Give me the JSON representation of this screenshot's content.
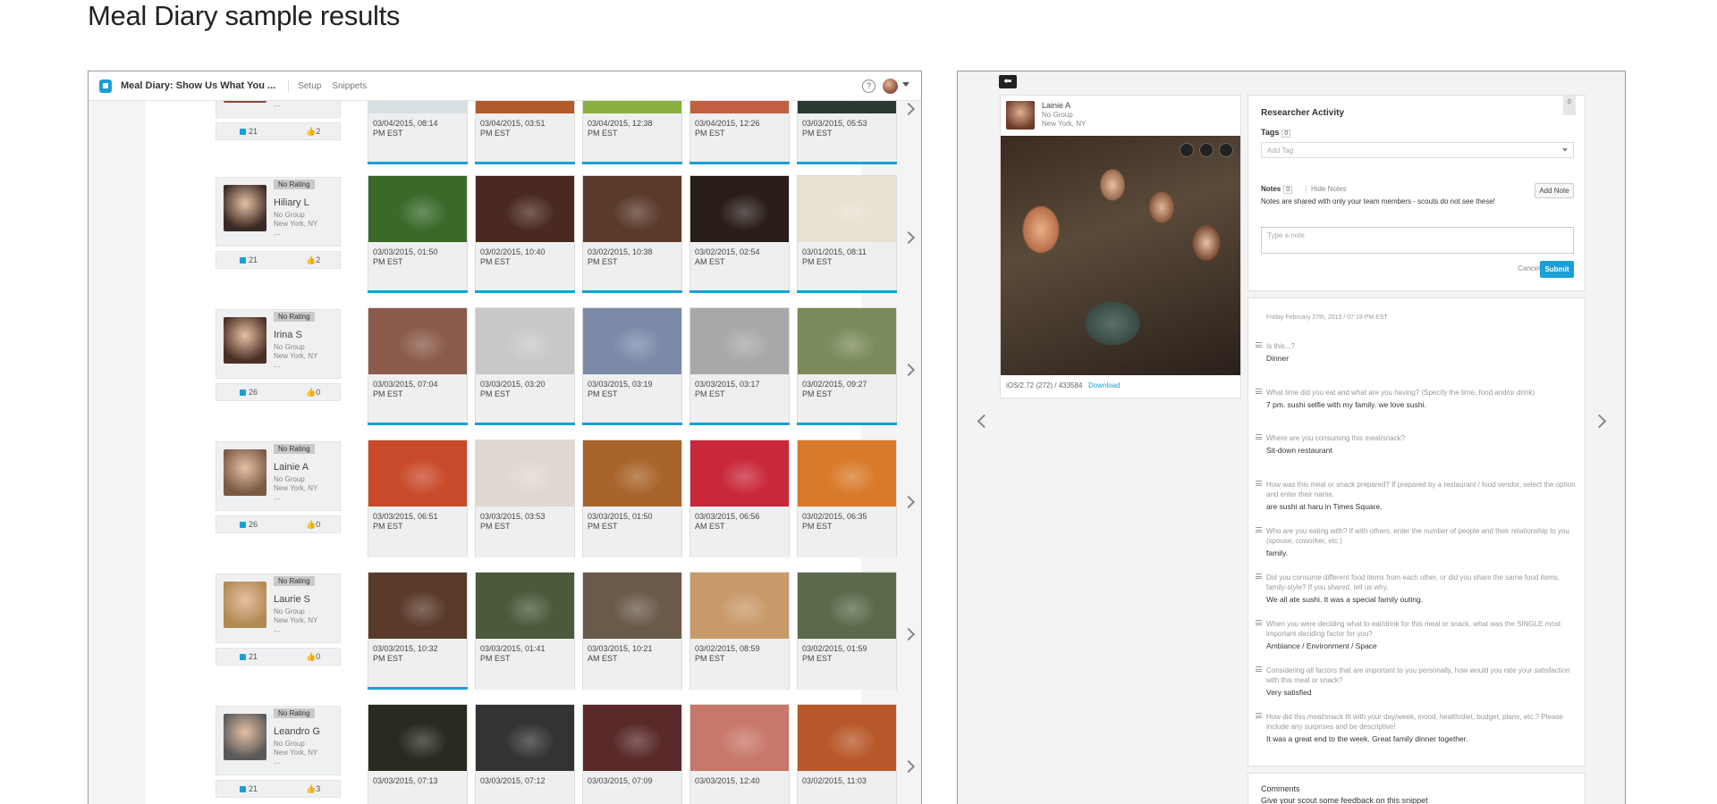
{
  "page_title": "Meal Diary sample results",
  "app": {
    "title": "Meal Diary: Show Us What You ...",
    "nav": [
      "Setup",
      "Snippets"
    ],
    "help_glyph": "?"
  },
  "scouts": [
    {
      "name": "",
      "rating": "",
      "group": "No Group",
      "location": "New York, NY",
      "more": "...",
      "snippets": "21",
      "likes": "2"
    },
    {
      "name": "Hiliary L",
      "rating": "No Rating",
      "group": "No Group",
      "location": "New York, NY",
      "more": "...",
      "snippets": "21",
      "likes": "2"
    },
    {
      "name": "Irina S",
      "rating": "No Rating",
      "group": "No Group",
      "location": "New York, NY",
      "more": "...",
      "snippets": "26",
      "likes": "0"
    },
    {
      "name": "Lainie A",
      "rating": "No Rating",
      "group": "No Group",
      "location": "New York, NY",
      "more": "...",
      "snippets": "26",
      "likes": "0"
    },
    {
      "name": "Laurie S",
      "rating": "No Rating",
      "group": "No Group",
      "location": "New York, NY",
      "more": "...",
      "snippets": "21",
      "likes": "0"
    },
    {
      "name": "Leandro G",
      "rating": "No Rating",
      "group": "No Group",
      "location": "New York, NY",
      "more": "...",
      "snippets": "21",
      "likes": "3"
    }
  ],
  "rows": [
    {
      "tiles": [
        {
          "date": "03/04/2015, 08:14",
          "tz": "PM EST",
          "sel": true
        },
        {
          "date": "03/04/2015, 03:51",
          "tz": "PM EST",
          "sel": true
        },
        {
          "date": "03/04/2015, 12:38",
          "tz": "PM EST",
          "sel": true
        },
        {
          "date": "03/04/2015, 12:26",
          "tz": "PM EST",
          "sel": true
        },
        {
          "date": "03/03/2015, 05:53",
          "tz": "PM EST",
          "sel": true
        }
      ]
    },
    {
      "tiles": [
        {
          "date": "03/03/2015, 01:50",
          "tz": "PM EST",
          "sel": true
        },
        {
          "date": "03/02/2015, 10:40",
          "tz": "PM EST",
          "sel": true
        },
        {
          "date": "03/02/2015, 10:38",
          "tz": "PM EST",
          "sel": true
        },
        {
          "date": "03/02/2015, 02:54",
          "tz": "AM EST",
          "sel": true
        },
        {
          "date": "03/01/2015, 08:11",
          "tz": "PM EST",
          "sel": true
        }
      ]
    },
    {
      "tiles": [
        {
          "date": "03/03/2015, 07:04",
          "tz": "PM EST",
          "sel": true
        },
        {
          "date": "03/03/2015, 03:20",
          "tz": "PM EST",
          "sel": true
        },
        {
          "date": "03/03/2015, 03:19",
          "tz": "PM EST",
          "sel": true
        },
        {
          "date": "03/03/2015, 03:17",
          "tz": "PM EST",
          "sel": true
        },
        {
          "date": "03/02/2015, 09:27",
          "tz": "PM EST",
          "sel": true
        }
      ]
    },
    {
      "tiles": [
        {
          "date": "03/03/2015, 06:51",
          "tz": "PM EST",
          "sel": false
        },
        {
          "date": "03/03/2015, 03:53",
          "tz": "PM EST",
          "sel": false
        },
        {
          "date": "03/03/2015, 01:50",
          "tz": "PM EST",
          "sel": false
        },
        {
          "date": "03/03/2015, 06:56",
          "tz": "AM EST",
          "sel": false
        },
        {
          "date": "03/02/2015, 06:35",
          "tz": "PM EST",
          "sel": false
        }
      ]
    },
    {
      "tiles": [
        {
          "date": "03/03/2015, 10:32",
          "tz": "PM EST",
          "sel": true
        },
        {
          "date": "03/03/2015, 01:41",
          "tz": "PM EST",
          "sel": false
        },
        {
          "date": "03/03/2015, 10:21",
          "tz": "AM EST",
          "sel": false
        },
        {
          "date": "03/02/2015, 08:59",
          "tz": "PM EST",
          "sel": false
        },
        {
          "date": "03/02/2015, 01:59",
          "tz": "PM EST",
          "sel": false
        }
      ]
    },
    {
      "tiles": [
        {
          "date": "03/03/2015, 07:13",
          "tz": "",
          "sel": false
        },
        {
          "date": "03/03/2015, 07:12",
          "tz": "",
          "sel": false
        },
        {
          "date": "03/03/2015, 07:09",
          "tz": "",
          "sel": false
        },
        {
          "date": "03/03/2015, 12:40",
          "tz": "",
          "sel": false
        },
        {
          "date": "03/02/2015, 11:03",
          "tz": "",
          "sel": false
        }
      ]
    }
  ],
  "detail": {
    "back_glyph": "⬅",
    "scout_name": "Lainie A",
    "scout_group": "No Group",
    "scout_location": "New York, NY",
    "meta": "iOS/2.72 (272) / 433584",
    "download_label": "Download",
    "activity_title": "Researcher Activity",
    "activity_count": "0",
    "tags_label": "Tags",
    "tags_count": "0",
    "tag_placeholder": "Add Tag",
    "notes_label": "Notes",
    "notes_count": "0",
    "hide_notes": "Hide Notes",
    "add_note_label": "Add Note",
    "notes_help": "Notes are shared with only your team members - scouts do not see these!",
    "note_placeholder": "Type a note",
    "cancel_label": "Cancel",
    "submit_label": "Submit",
    "answer_date": "Friday February 27th, 2015 / 07:19 PM EST",
    "qa": [
      {
        "q": "Is this...?",
        "a": "Dinner"
      },
      {
        "q": "What time did you eat and what are you having? (Specify the time, food and/or drink)",
        "a": "7 pm. sushi selfie with my family. we love sushi."
      },
      {
        "q": "Where are you consuming this meal/snack?",
        "a": "Sit-down restaurant"
      },
      {
        "q": "How was this meal or snack prepared? If prepared by a restaurant / food vendor, select the option and enter their name.",
        "a": "are sushi at haru in Times Square."
      },
      {
        "q": "Who are you eating with? If with others, enter the number of people and their relationship to you (spouse, coworker, etc.)",
        "a": "family."
      },
      {
        "q": "Did you consume different food items from each other, or did you share the same food items, family-style? If you shared, tell us why.",
        "a": "We all ate sushi. It was a special family outing."
      },
      {
        "q": "When you were deciding what to eat/drink for this meal or snack, what was the SINGLE most important deciding factor for you?",
        "a": "Ambiance / Environment / Space"
      },
      {
        "q": "Considering all factors that are important to you personally, how would you rate your satisfaction with this meal or snack?",
        "a": "Very satisfied"
      },
      {
        "q": "How did this meal/snack fit with your day/week, mood, health/diet, budget, plans, etc.? Please include any surprises and be descriptive!",
        "a": "It was a great end to the week. Great family dinner together."
      }
    ],
    "comments_title": "Comments",
    "comments_help": "Give your scout some feedback on this snippet"
  },
  "colors": {
    "accent": "#1a9fd6"
  }
}
